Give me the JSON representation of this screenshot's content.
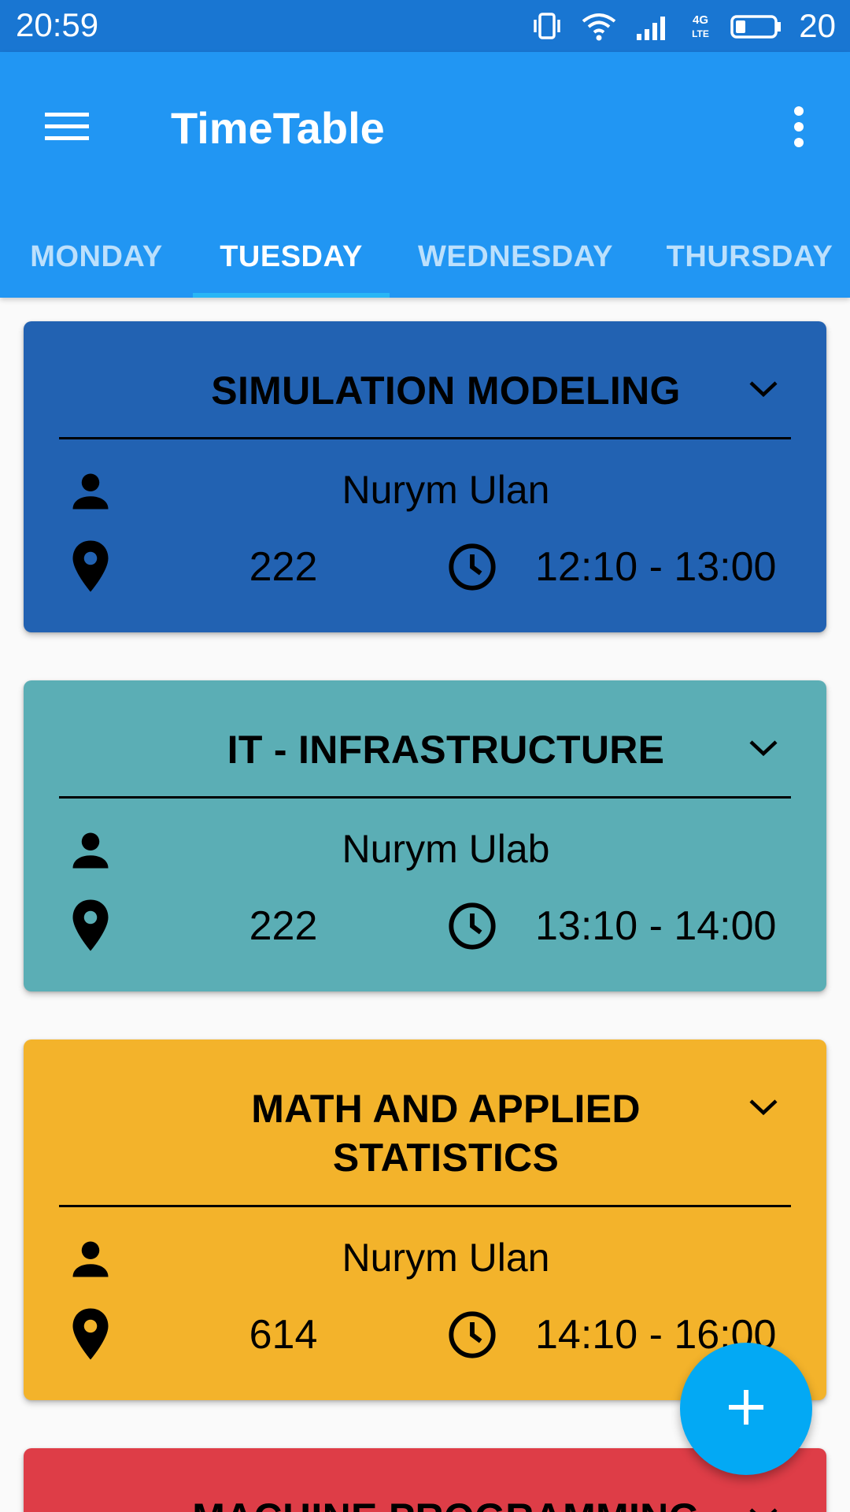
{
  "status_bar": {
    "time": "20:59",
    "network_label": "4G LTE",
    "battery_percent": "20"
  },
  "app_bar": {
    "title": "TimeTable",
    "menu_icon": "hamburger-menu-icon",
    "overflow_icon": "more-vert-icon"
  },
  "tabs": {
    "items": [
      {
        "label": "MONDAY"
      },
      {
        "label": "TUESDAY"
      },
      {
        "label": "WEDNESDAY"
      },
      {
        "label": "THURSDAY"
      }
    ],
    "active": "TUESDAY",
    "indicator_color": "#29B6F6"
  },
  "classes": [
    {
      "title": "SIMULATION MODELING",
      "teacher": "Nurym Ulan",
      "room": "222",
      "time": "12:10 - 13:00",
      "color": "#2262B2"
    },
    {
      "title": "IT - INFRASTRUCTURE",
      "teacher": "Nurym Ulab",
      "room": "222",
      "time": "13:10 - 14:00",
      "color": "#5BAEB5"
    },
    {
      "title_line1": "MATH AND APPLIED",
      "title_line2": "STATISTICS",
      "teacher": "Nurym Ulan",
      "room": "614",
      "time": "14:10 - 16:00",
      "color": "#F3B32B"
    },
    {
      "title": "MACHINE PROGRAMMING",
      "color": "#DE3D47"
    }
  ],
  "colors": {
    "status_bar": "#1976D2",
    "app_bar": "#2196F3",
    "fab": "#03A9F4"
  },
  "fab": {
    "icon": "add-icon"
  }
}
